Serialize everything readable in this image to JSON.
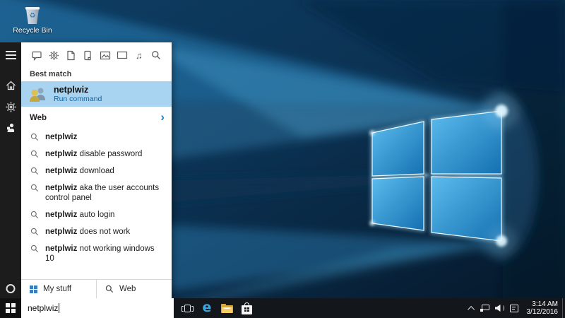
{
  "desktop": {
    "recycle_bin_label": "Recycle Bin"
  },
  "search_panel": {
    "filter_icons": [
      "chat",
      "settings",
      "document",
      "tablet",
      "photos",
      "video",
      "music",
      "search"
    ],
    "best_match_header": "Best match",
    "best_match": {
      "title": "netplwiz",
      "subtitle": "Run command"
    },
    "web_header": "Web",
    "suggestions": [
      {
        "bold": "netplwiz",
        "rest": ""
      },
      {
        "bold": "netplwiz",
        "rest": " disable password"
      },
      {
        "bold": "netplwiz",
        "rest": " download"
      },
      {
        "bold": "netplwiz",
        "rest": " aka the user accounts control panel"
      },
      {
        "bold": "netplwiz",
        "rest": " auto login"
      },
      {
        "bold": "netplwiz",
        "rest": " does not work"
      },
      {
        "bold": "netplwiz",
        "rest": " not working windows 10"
      }
    ],
    "footer": {
      "my_stuff_label": "My stuff",
      "web_label": "Web"
    }
  },
  "taskbar": {
    "search_value": "netplwiz",
    "tray": {
      "time": "3:14 AM",
      "date": "3/12/2016"
    }
  },
  "colors": {
    "best_match_highlight": "#a9d4f1",
    "run_command_blue": "#15639c",
    "web_chevron_blue": "#1b86c5",
    "taskbar_bg": "#13161a",
    "sidebar_bg": "#1c1c1c",
    "my_stuff_flag_blue": "#3e7cba"
  }
}
